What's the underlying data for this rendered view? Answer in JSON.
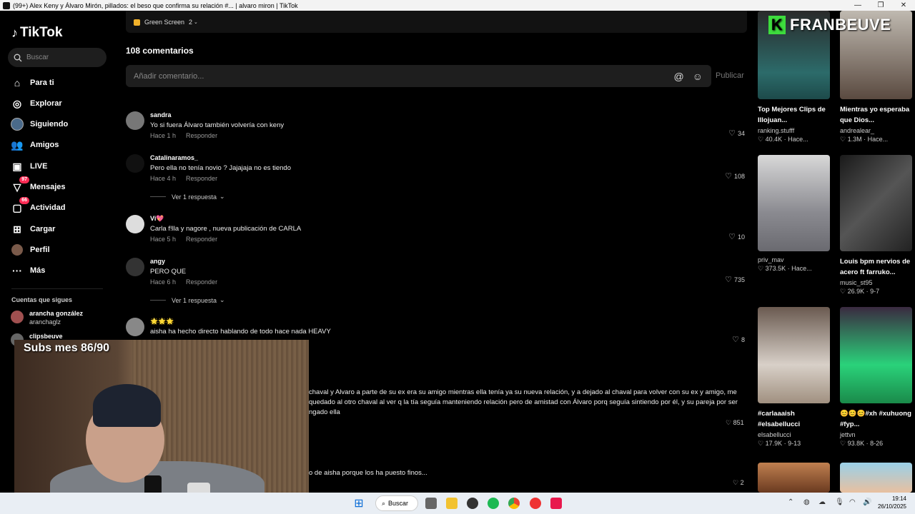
{
  "window": {
    "title": "(99+) Alex Keny y Álvaro Mirón, pillados: el beso que confirma su relación #... | alvaro miron | TikTok",
    "minimize": "—",
    "maximize": "❐",
    "close": "✕"
  },
  "sidebar": {
    "logo": "TikTok",
    "search_placeholder": "Buscar",
    "items": [
      {
        "label": "Para ti",
        "icon": "home-icon"
      },
      {
        "label": "Explorar",
        "icon": "compass-icon"
      },
      {
        "label": "Siguiendo",
        "icon": "following-icon"
      },
      {
        "label": "Amigos",
        "icon": "friends-icon"
      },
      {
        "label": "LIVE",
        "icon": "live-icon"
      },
      {
        "label": "Mensajes",
        "icon": "messages-icon",
        "badge": "97"
      },
      {
        "label": "Actividad",
        "icon": "activity-icon",
        "badge": "66"
      },
      {
        "label": "Cargar",
        "icon": "upload-icon"
      },
      {
        "label": "Perfil",
        "icon": "profile-icon"
      },
      {
        "label": "Más",
        "icon": "more-icon"
      }
    ],
    "following_header": "Cuentas que sigues",
    "following": [
      {
        "name": "arancha gonzález",
        "handle": "aranchaglz"
      },
      {
        "name": "clipsbeuve",
        "handle": ""
      }
    ]
  },
  "main": {
    "green_screen": "Green Screen",
    "green_count": "2",
    "comment_count": "108 comentarios",
    "comment_placeholder": "Añadir comentario...",
    "publish": "Publicar",
    "comments": [
      {
        "user": "sandra",
        "text": "Yo si fuera Álvaro también volvería con keny",
        "time": "Hace 1 h",
        "reply": "Responder",
        "likes": "34"
      },
      {
        "user": "Catalinaramos_",
        "text": "Pero ella no tenía novio ? Jajajaja no es tiendo",
        "time": "Hace 4 h",
        "reply": "Responder",
        "likes": "108",
        "more": "Ver 1 respuesta"
      },
      {
        "user": "Vi💖",
        "text": "Carla f!lla y nagore , nueva publicación de CARLA",
        "time": "Hace 5 h",
        "reply": "Responder",
        "likes": "10"
      },
      {
        "user": "angy",
        "text": "PERO QUE",
        "time": "Hace 6 h",
        "reply": "Responder",
        "likes": "735",
        "more": "Ver 1 respuesta"
      },
      {
        "user": "🌟🌟🌟",
        "text": "aisha ha hecho directo hablando de todo hace nada HEAVY",
        "time": "",
        "reply": "",
        "likes": "8"
      }
    ],
    "partial_1": "chaval y Alvaro a parte de su ex era su amigo mientras ella tenía ya su nueva relación, y a dejado al chaval para volver con su ex y amigo, me",
    "partial_2": "quedado al otro chaval al ver q la tía seguía manteniendo relación pero de amistad con Álvaro porq seguía sintiendo por él, y su pareja por ser",
    "partial_3": "ngado ella",
    "partial_likes": "851",
    "partial_4": "o de aisha porque los ha puesto finos...",
    "partial_likes_2": "2"
  },
  "overlay": {
    "channel": "FRANBEUVE",
    "channel_badge": "K",
    "subs": "Subs mes 86/90"
  },
  "videos": [
    {
      "title": "Top Mejores Clips de Illojuan...",
      "user": "ranking.stufff",
      "meta": "♡ 40.4K · Hace..."
    },
    {
      "title": "Mientras yo esperaba que Dios...",
      "user": "andrealear_",
      "meta": "♡ 1.3M · Hace..."
    },
    {
      "title": "",
      "user": "priv_mav",
      "meta": "♡ 373.5K · Hace..."
    },
    {
      "title": "Louis bpm nervios de acero ft farruko...",
      "user": "music_st95",
      "meta": "♡ 26.9K · 9-7"
    },
    {
      "title": "#carlaaaish #elsabellucci",
      "user": "elsabellucci",
      "meta": "♡ 17.9K · 9-13"
    },
    {
      "title": "😊😊😊#xh #xuhuong #fyp...",
      "user": "jettvn",
      "meta": "♡ 93.8K · 8-26"
    }
  ],
  "taskbar": {
    "search": "Buscar",
    "time": "19:14",
    "date": "26/10/2025"
  }
}
